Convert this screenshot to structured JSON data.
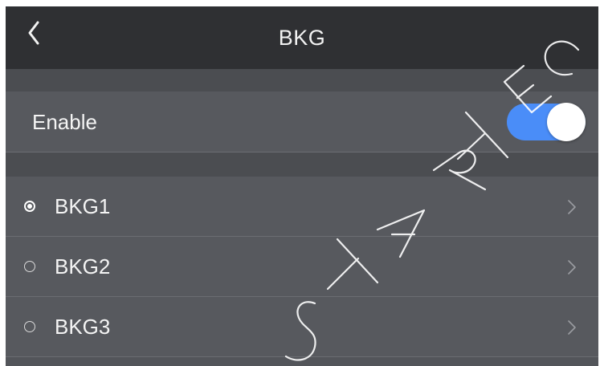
{
  "header": {
    "title": "BKG",
    "back_icon": "chevron-left-icon"
  },
  "enable": {
    "label": "Enable",
    "on": true,
    "toggle_color": "#4a8df8"
  },
  "backgrounds": [
    {
      "label": "BKG1",
      "selected": true
    },
    {
      "label": "BKG2",
      "selected": false
    },
    {
      "label": "BKG3",
      "selected": false
    }
  ],
  "watermark": {
    "text": "STAR TECH"
  }
}
